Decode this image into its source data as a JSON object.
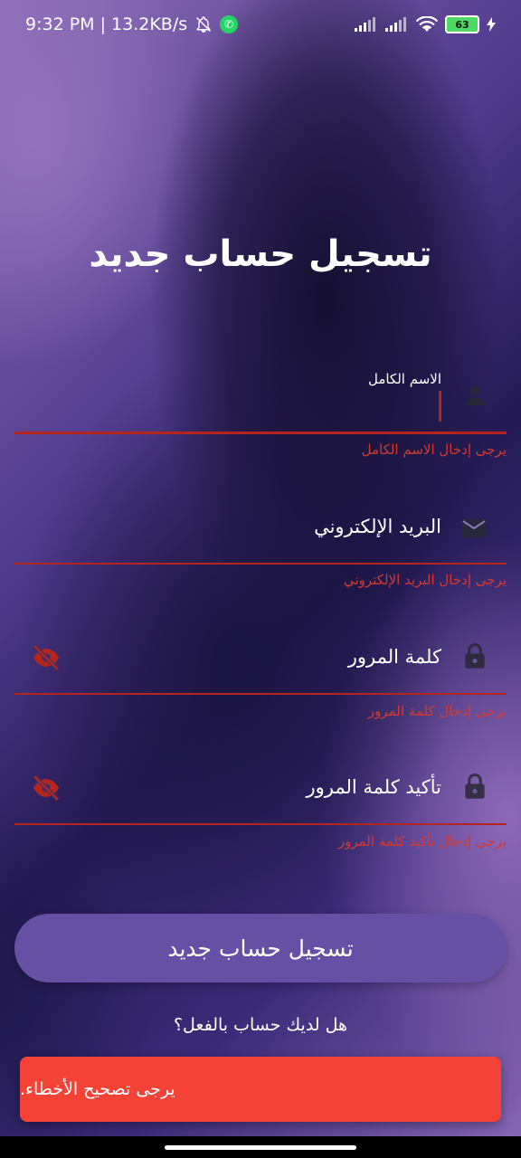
{
  "status_bar": {
    "time_speed": "9:32 PM | 13.2KB/s",
    "battery": "63"
  },
  "page": {
    "title": "تسجيل حساب جديد"
  },
  "fields": {
    "full_name": {
      "label": "الاسم الكامل",
      "error": "يرجى إدخال الاسم الكامل"
    },
    "email": {
      "label": "البريد الإلكتروني",
      "error": "يرجى إدخال البريد الإلكتروني"
    },
    "password": {
      "label": "كلمة المرور",
      "error": "يرجى إدخال كلمة المرور"
    },
    "confirm_password": {
      "label": "تأكيد كلمة المرور",
      "error": "يرجى إدخال تأكيد كلمة المرور"
    }
  },
  "buttons": {
    "register": "تسجيل حساب جديد",
    "have_account": "هل لديك حساب بالفعل؟"
  },
  "snackbar": {
    "message": "يرجى تصحيح الأخطاء."
  },
  "colors": {
    "error": "#b3261e",
    "button": "#6550a6",
    "snackbar": "#f44336"
  },
  "icons": [
    "person-icon",
    "email-icon",
    "lock-icon",
    "visibility-off-icon",
    "bell-off-icon",
    "whatsapp-icon",
    "signal-icon",
    "wifi-icon",
    "battery-icon",
    "charging-icon"
  ]
}
